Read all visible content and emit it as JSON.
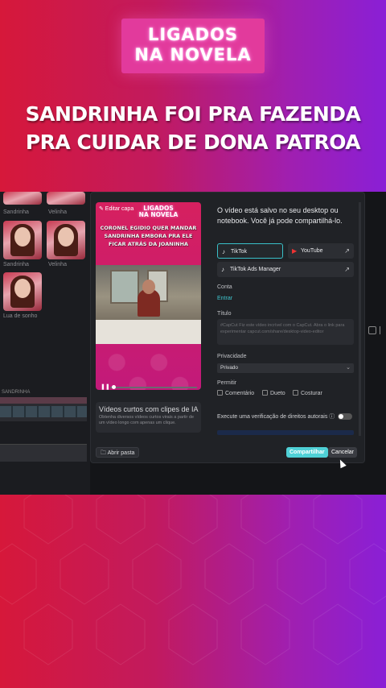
{
  "logo": {
    "line1": "LIGADOS",
    "line2": "NA NOVELA"
  },
  "headline": {
    "line1": "SANDRINHA FOI PRA FAZENDA",
    "line2": "PRA CUIDAR DE DONA PATROA"
  },
  "editor": {
    "media_labels": [
      "Sandrinha",
      "Velinha",
      "Lua de sonho"
    ],
    "timeline_label": "SANDRINHA"
  },
  "dialog": {
    "preview": {
      "edit_cover": "✎ Editar capa",
      "logo_line1": "LIGADOS",
      "logo_line2": "NA NOVELA",
      "caption": "CORONEL EGIDIO QUER MANDAR SANDRINHA EMBORA PRA ELE FICAR ATRÁS DA JOANINHA",
      "play_icon": "pause-icon"
    },
    "ai_card": {
      "title": "Vídeos curtos com clipes de IA",
      "subtitle": "Obtenha diversos vídeos curtos virais a partir de um vídeo longo com apenas um clique."
    },
    "open_folder": "Abrir pasta",
    "saved_message": "O vídeo está salvo no seu desktop ou notebook. Você já pode compartilhá-lo.",
    "platforms": [
      {
        "label": "TikTok",
        "icon": "tiktok-icon",
        "selected": true
      },
      {
        "label": "YouTube",
        "icon": "youtube-icon",
        "selected": false
      },
      {
        "label": "TikTok Ads Manager",
        "icon": "tiktok-icon",
        "selected": false
      }
    ],
    "account_label": "Conta",
    "login_link": "Entrar",
    "title_label": "Título",
    "title_placeholder": "#CapCut Fiz este vídeo incrível com o CapCut. Abra o link para experimentar capcut.com/share/desktop-video-editor",
    "privacy_label": "Privacidade",
    "privacy_value": "Privado",
    "allow_label": "Permitir",
    "allow_options": [
      "Comentário",
      "Dueto",
      "Costurar"
    ],
    "rights_check": "Execute uma verificação de direitos autorais ⓘ",
    "share_button": "Compartilhar",
    "cancel_button": "Cancelar"
  },
  "colors": {
    "accent": "#4fd0d6",
    "link": "#3fc6cf",
    "bg_left": "#d6183a",
    "bg_right": "#8a1fd6"
  }
}
